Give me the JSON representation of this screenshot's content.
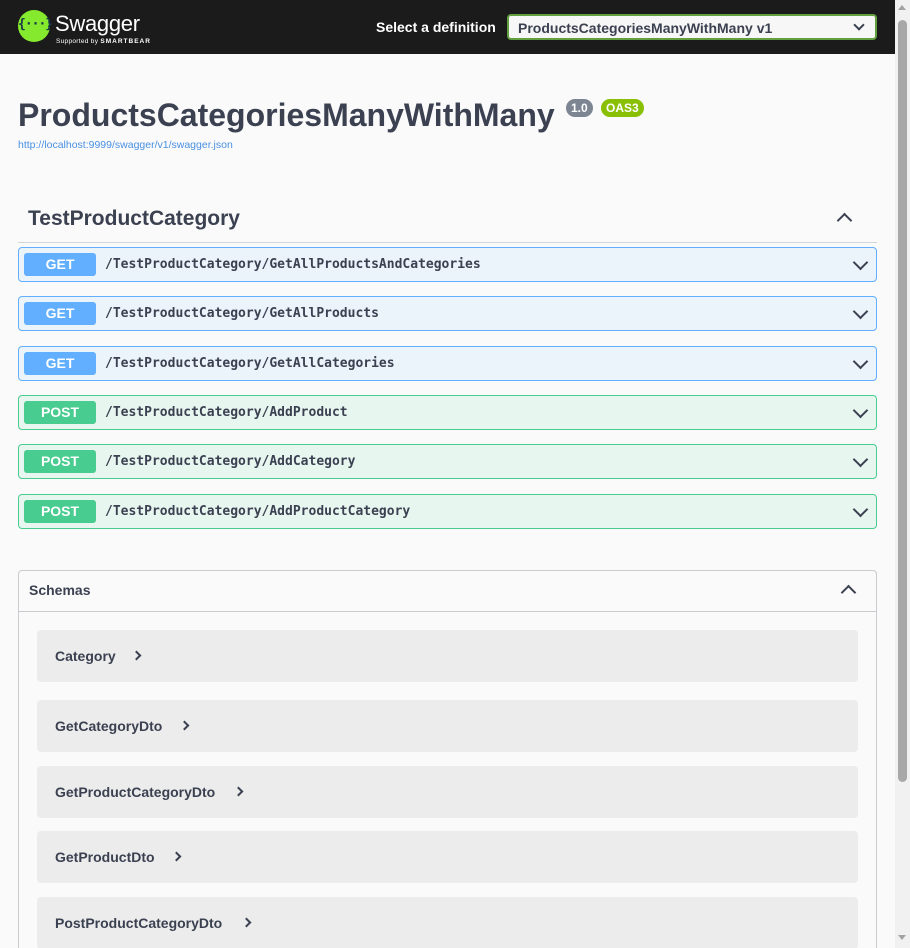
{
  "topbar": {
    "logo_glyph": "{···}",
    "brand": "Swagger",
    "brand_sub_prefix": "Supported by",
    "brand_sub_company": "SMARTBEAR",
    "select_label": "Select a definition",
    "selected_definition": "ProductsCategoriesManyWithMany v1"
  },
  "info": {
    "title": "ProductsCategoriesManyWithMany",
    "version": "1.0",
    "oas_badge": "OAS3",
    "url": "http://localhost:9999/swagger/v1/swagger.json"
  },
  "tag": {
    "name": "TestProductCategory"
  },
  "operations": [
    {
      "method": "GET",
      "path": "/TestProductCategory/GetAllProductsAndCategories"
    },
    {
      "method": "GET",
      "path": "/TestProductCategory/GetAllProducts"
    },
    {
      "method": "GET",
      "path": "/TestProductCategory/GetAllCategories"
    },
    {
      "method": "POST",
      "path": "/TestProductCategory/AddProduct"
    },
    {
      "method": "POST",
      "path": "/TestProductCategory/AddCategory"
    },
    {
      "method": "POST",
      "path": "/TestProductCategory/AddProductCategory"
    }
  ],
  "schemas": {
    "title": "Schemas",
    "models": [
      "Category",
      "GetCategoryDto",
      "GetProductCategoryDto",
      "GetProductDto",
      "PostProductCategoryDto"
    ]
  },
  "colors": {
    "topbar": "#1b1b1b",
    "brand_green": "#85ea2d",
    "get": "#61affe",
    "post": "#49cc90",
    "version_badge": "#7d8492",
    "oas_badge": "#89bf04",
    "link": "#4990e2"
  },
  "icons": {
    "expand": "chevron-down-icon",
    "collapse": "chevron-up-icon",
    "model_expand": "chevron-right-icon"
  }
}
